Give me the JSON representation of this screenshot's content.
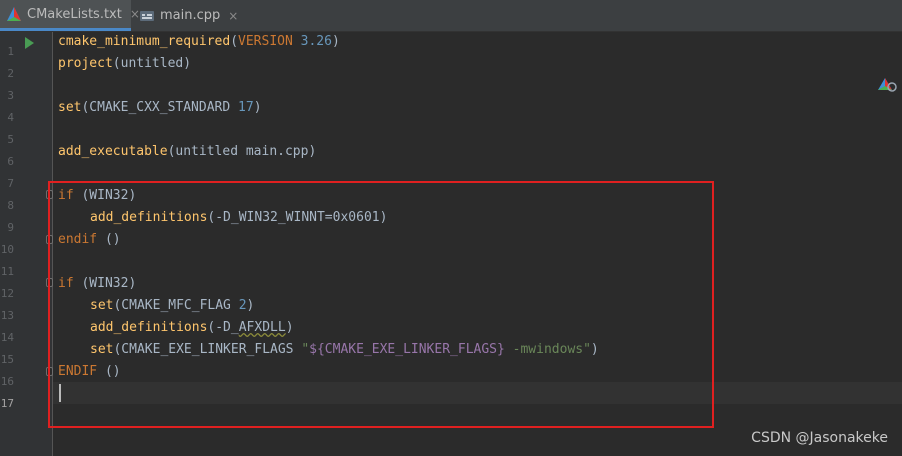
{
  "tabs": [
    {
      "label": "CMakeLists.txt",
      "close": "×",
      "icon": "cmake-file-icon",
      "active": true
    },
    {
      "label": "main.cpp",
      "close": "×",
      "icon": "cpp-file-icon",
      "active": false
    }
  ],
  "line_numbers": [
    "1",
    "2",
    "3",
    "4",
    "5",
    "6",
    "7",
    "8",
    "9",
    "10",
    "11",
    "12",
    "13",
    "14",
    "15",
    "16",
    "17"
  ],
  "current_line": "17",
  "code": {
    "l1": {
      "fn": "cmake_minimum_required",
      "open": "(",
      "arg": "VERSION",
      "num": "3.26",
      "close": ")"
    },
    "l2": {
      "fn": "project",
      "rest": "(untitled)"
    },
    "l4": {
      "fn": "set",
      "open": "(CMAKE_CXX_STANDARD ",
      "num": "17",
      "close": ")"
    },
    "l6": {
      "fn": "add_executable",
      "rest": "(untitled main.cpp)"
    },
    "l8": {
      "kw": "if",
      "rest": " (WIN32)"
    },
    "l9": {
      "fn": "add_definitions",
      "rest": "(-D_WIN32_WINNT=0x0601)"
    },
    "l10": {
      "kw": "endif",
      "rest": " ()"
    },
    "l12": {
      "kw": "if",
      "rest": " (WIN32)"
    },
    "l13": {
      "fn": "set",
      "open": "(CMAKE_MFC_FLAG ",
      "num": "2",
      "close": ")"
    },
    "l14": {
      "fn": "add_definitions",
      "open": "(-D_",
      "warn": "AFXDLL",
      "close": ")"
    },
    "l15": {
      "fn": "set",
      "open": "(CMAKE_EXE_LINKER_FLAGS ",
      "q1": "\"",
      "var": "${CMAKE_EXE_LINKER_FLAGS}",
      "str": " -mwindows\"",
      "close": ")"
    },
    "l16": {
      "kw": "ENDIF",
      "rest": " ()"
    }
  },
  "watermark": "CSDN @Jasonakeke",
  "colors": {
    "highlight_box": "#e02020",
    "background": "#2b2b2b"
  }
}
